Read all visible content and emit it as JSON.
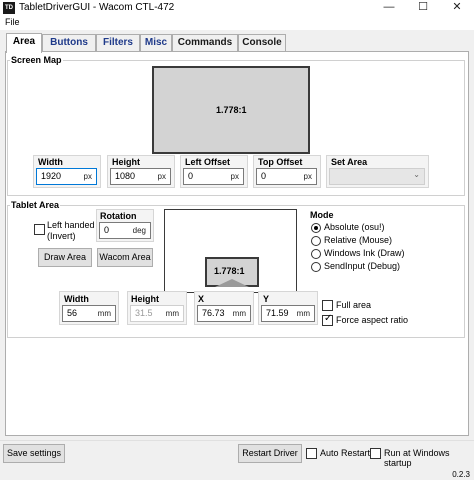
{
  "window": {
    "app_icon": "TD",
    "title": "TabletDriverGUI - Wacom CTL-472",
    "minimize_icon": "minimize-icon",
    "maximize_icon": "maximize-icon",
    "close_icon": "close-icon"
  },
  "menu": {
    "file": "File"
  },
  "tabs": [
    {
      "label": "Area",
      "active": true
    },
    {
      "label": "Buttons"
    },
    {
      "label": "Filters"
    },
    {
      "label": "Misc"
    },
    {
      "label": "Commands"
    },
    {
      "label": "Console"
    }
  ],
  "screen_map": {
    "label": "Screen Map",
    "ratio": "1.778:1",
    "width_label": "Width",
    "width_value": "1920",
    "width_unit": "px",
    "height_label": "Height",
    "height_value": "1080",
    "height_unit": "px",
    "left_offset_label": "Left Offset",
    "left_offset_value": "0",
    "left_offset_unit": "px",
    "top_offset_label": "Top Offset",
    "top_offset_value": "0",
    "top_offset_unit": "px",
    "set_area_label": "Set Area",
    "set_area_value": ""
  },
  "tablet_area": {
    "label": "Tablet Area",
    "left_handed_label_1": "Left handed",
    "left_handed_label_2": "(Invert)",
    "left_handed_checked": false,
    "rotation_label": "Rotation",
    "rotation_value": "0",
    "rotation_unit": "deg",
    "draw_area_button": "Draw Area",
    "wacom_area_button": "Wacom Area",
    "ratio": "1.778:1",
    "width_label": "Width",
    "width_value": "56",
    "width_unit": "mm",
    "height_label": "Height",
    "height_value": "31.5",
    "height_unit": "mm",
    "x_label": "X",
    "x_value": "76.73",
    "x_unit": "mm",
    "y_label": "Y",
    "y_value": "71.59",
    "y_unit": "mm",
    "full_area_label": "Full area",
    "full_area_checked": false,
    "force_aspect_label": "Force aspect ratio",
    "force_aspect_checked": true
  },
  "mode": {
    "label": "Mode",
    "options": [
      {
        "label": "Absolute (osu!)",
        "selected": true
      },
      {
        "label": "Relative (Mouse)",
        "selected": false
      },
      {
        "label": "Windows Ink (Draw)",
        "selected": false
      },
      {
        "label": "SendInput (Debug)",
        "selected": false
      }
    ]
  },
  "bottom": {
    "save_settings": "Save settings",
    "restart_driver": "Restart Driver",
    "auto_restart": "Auto Restart",
    "run_at_startup": "Run at Windows startup",
    "version": "0.2.3"
  }
}
